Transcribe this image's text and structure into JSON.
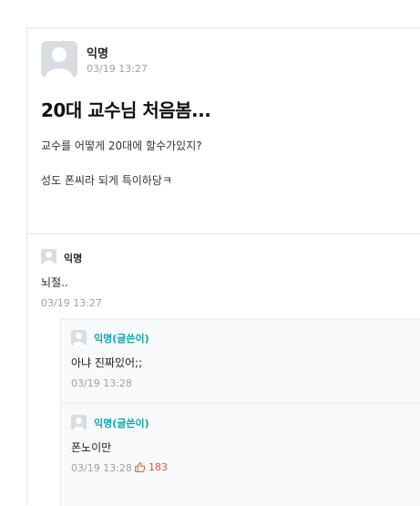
{
  "post": {
    "author": "익명",
    "time": "03/19 13:27",
    "title": "20대 교수님 처음봄...",
    "paragraphs": [
      "교수를 어떻게 20대에 할수가있지?",
      "성도 폰씨라 되게 특이하당ㅋ"
    ],
    "avatar_icon": "default-avatar-icon"
  },
  "comments": [
    {
      "author": "익명",
      "text": "뇌절..",
      "time": "03/19 13:27",
      "replies": [
        {
          "author": "익명(글쓴이)",
          "text": "아냐 진짜있어;;",
          "time": "03/19 13:28"
        },
        {
          "author": "익명(글쓴이)",
          "text": "폰노이만",
          "time": "03/19 13:28",
          "vote_icon": "thumbs-up-icon",
          "votes": "183"
        }
      ]
    }
  ],
  "colors": {
    "writer_accent": "#0ca5b0",
    "vote_accent": "#e0533d",
    "meta_gray": "#a0a0a0",
    "reply_bg": "#f8f9fa",
    "avatar_bg": "#d9dde1"
  }
}
